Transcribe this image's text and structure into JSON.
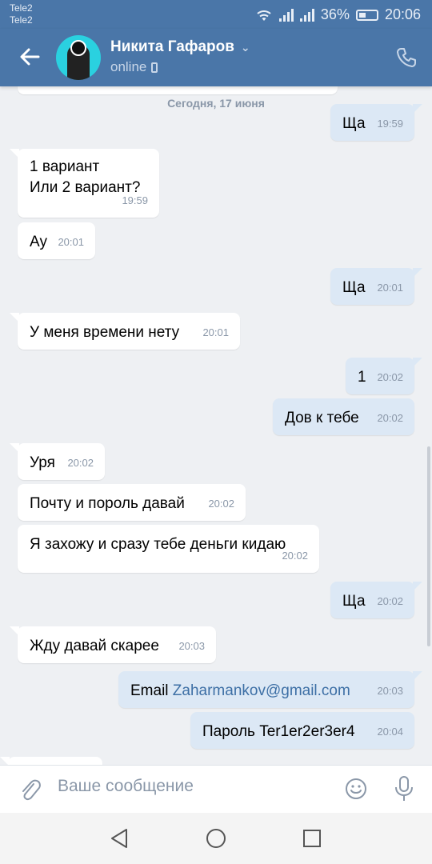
{
  "statusbar": {
    "carrier1": "Tele2",
    "carrier2": "Tele2",
    "battery": "36%",
    "time": "20:06"
  },
  "header": {
    "name": "Никита Гафаров",
    "chevron": "⌄",
    "status": "online"
  },
  "chat": {
    "date": "Сегодня, 17 июня",
    "messages": [
      {
        "dir": "out",
        "text": "Ща",
        "time": "19:59"
      },
      {
        "dir": "in",
        "text": "1 вариант",
        "text2": "Или 2 вариант?",
        "time": "19:59"
      },
      {
        "dir": "in",
        "text": "Ау",
        "time": "20:01"
      },
      {
        "dir": "out",
        "text": "Ща",
        "time": "20:01"
      },
      {
        "dir": "in",
        "text": "У меня времени нету",
        "time": "20:01"
      },
      {
        "dir": "out",
        "text": "1",
        "time": "20:02"
      },
      {
        "dir": "out",
        "text": "Дов к тебе",
        "time": "20:02"
      },
      {
        "dir": "in",
        "text": "Уря",
        "time": "20:02"
      },
      {
        "dir": "in",
        "text": "Почту и пороль давай",
        "time": "20:02"
      },
      {
        "dir": "in",
        "text": "Я захожу и сразу тебе деньги кидаю",
        "time": "20:02"
      },
      {
        "dir": "out",
        "text": "Ща",
        "time": "20:02"
      },
      {
        "dir": "in",
        "text": "Жду давай скарее",
        "time": "20:03"
      },
      {
        "dir": "out",
        "text": "Email",
        "email": "Zaharmankov@gmail.com",
        "time": "20:03"
      },
      {
        "dir": "out",
        "text": "Пароль Ter1er2er3er4",
        "time": "20:04"
      }
    ]
  },
  "composer": {
    "placeholder": "Ваше сообщение"
  },
  "colors": {
    "header": "#4a76a8",
    "incoming_bubble": "#ffffff",
    "outgoing_bubble": "#dce8f5",
    "link": "#3d6fa5"
  },
  "icons": [
    "wifi-icon",
    "signal-icon",
    "battery-icon",
    "back-arrow-icon",
    "phone-icon",
    "paperclip-icon",
    "smile-icon",
    "microphone-icon",
    "nav-back-icon",
    "nav-home-icon",
    "nav-recents-icon"
  ]
}
